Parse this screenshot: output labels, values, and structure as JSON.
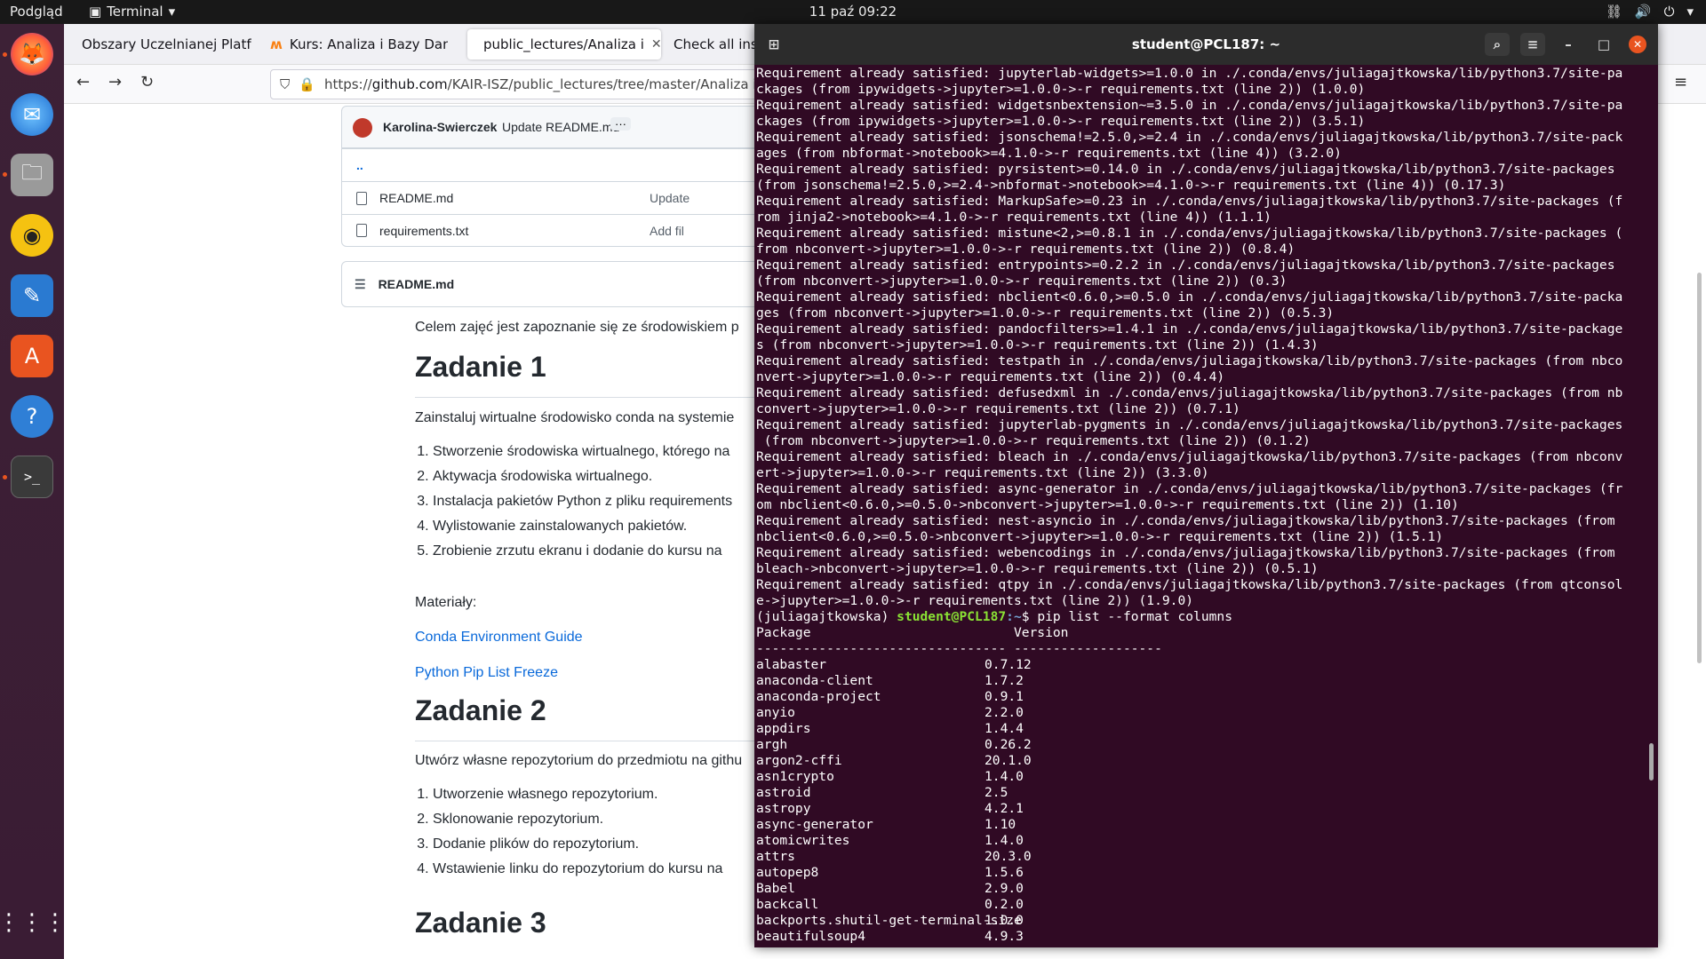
{
  "topbar": {
    "activities": "Podgląd",
    "app": "Terminal",
    "clock": "11 paź  09:22"
  },
  "dock": {
    "items": [
      "firefox-icon",
      "thunderbird-icon",
      "files-icon",
      "rhythmbox-icon",
      "writer-icon",
      "software-icon",
      "help-icon",
      "terminal-icon",
      "apps-grid-icon"
    ]
  },
  "browser": {
    "tabs": [
      {
        "label": "Obszary Uczelnianej Platf",
        "favicon": "#e07b00"
      },
      {
        "label": "Kurs: Analiza i Bazy Dany",
        "favicon": "#f98012"
      },
      {
        "label": "public_lectures/Analiza i",
        "favicon": "#24292f"
      },
      {
        "label": "Check all insta",
        "favicon": ""
      }
    ],
    "url_prefix": "https://",
    "url_domain": "github.com",
    "url_path": "/KAIR-ISZ/public_lectures/tree/master/Analiza i Ba"
  },
  "github": {
    "commit_author": "Karolina-Swierczek",
    "commit_msg": "Update README.md",
    "parent": "..",
    "files": [
      {
        "name": "README.md",
        "commit": "Update"
      },
      {
        "name": "requirements.txt",
        "commit": "Add fil"
      }
    ],
    "readme_title": "README.md",
    "intro": "Celem zajęć jest zapoznanie się ze środowiskiem p",
    "z1": "Zadanie 1",
    "z1_text": "Zainstaluj wirtualne środowisko conda na systemie",
    "z1_items": [
      "Stworzenie środowiska wirtualnego, którego na",
      "Aktywacja środowiska wirtualnego.",
      "Instalacja pakietów Python z pliku requirements",
      "Wylistowanie zainstalowanych pakietów.",
      "Zrobienie zrzutu ekranu i dodanie do kursu na"
    ],
    "materials": "Materiały:",
    "link1": "Conda Environment Guide",
    "link2": "Python Pip List Freeze",
    "z2": "Zadanie 2",
    "z2_text": "Utwórz własne repozytorium do przedmiotu na githu",
    "z2_items": [
      "Utworzenie własnego repozytorium.",
      "Sklonowanie repozytorium.",
      "Dodanie plików do repozytorium.",
      "Wstawienie linku do repozytorium do kursu na"
    ],
    "z3": "Zadanie 3"
  },
  "terminal": {
    "title": "student@PCL187: ~",
    "lines": [
      "Requirement already satisfied: jupyterlab-widgets>=1.0.0 in ./.conda/envs/juliagajtkowska/lib/python3.7/site-pa",
      "ckages (from ipywidgets->jupyter>=1.0.0->-r requirements.txt (line 2)) (1.0.0)",
      "Requirement already satisfied: widgetsnbextension~=3.5.0 in ./.conda/envs/juliagajtkowska/lib/python3.7/site-pa",
      "ckages (from ipywidgets->jupyter>=1.0.0->-r requirements.txt (line 2)) (3.5.1)",
      "Requirement already satisfied: jsonschema!=2.5.0,>=2.4 in ./.conda/envs/juliagajtkowska/lib/python3.7/site-pack",
      "ages (from nbformat->notebook>=4.1.0->-r requirements.txt (line 4)) (3.2.0)",
      "Requirement already satisfied: pyrsistent>=0.14.0 in ./.conda/envs/juliagajtkowska/lib/python3.7/site-packages",
      "(from jsonschema!=2.5.0,>=2.4->nbformat->notebook>=4.1.0->-r requirements.txt (line 4)) (0.17.3)",
      "Requirement already satisfied: MarkupSafe>=0.23 in ./.conda/envs/juliagajtkowska/lib/python3.7/site-packages (f",
      "rom jinja2->notebook>=4.1.0->-r requirements.txt (line 4)) (1.1.1)",
      "Requirement already satisfied: mistune<2,>=0.8.1 in ./.conda/envs/juliagajtkowska/lib/python3.7/site-packages (",
      "from nbconvert->jupyter>=1.0.0->-r requirements.txt (line 2)) (0.8.4)",
      "Requirement already satisfied: entrypoints>=0.2.2 in ./.conda/envs/juliagajtkowska/lib/python3.7/site-packages",
      "(from nbconvert->jupyter>=1.0.0->-r requirements.txt (line 2)) (0.3)",
      "Requirement already satisfied: nbclient<0.6.0,>=0.5.0 in ./.conda/envs/juliagajtkowska/lib/python3.7/site-packa",
      "ges (from nbconvert->jupyter>=1.0.0->-r requirements.txt (line 2)) (0.5.3)",
      "Requirement already satisfied: pandocfilters>=1.4.1 in ./.conda/envs/juliagajtkowska/lib/python3.7/site-package",
      "s (from nbconvert->jupyter>=1.0.0->-r requirements.txt (line 2)) (1.4.3)",
      "Requirement already satisfied: testpath in ./.conda/envs/juliagajtkowska/lib/python3.7/site-packages (from nbco",
      "nvert->jupyter>=1.0.0->-r requirements.txt (line 2)) (0.4.4)",
      "Requirement already satisfied: defusedxml in ./.conda/envs/juliagajtkowska/lib/python3.7/site-packages (from nb",
      "convert->jupyter>=1.0.0->-r requirements.txt (line 2)) (0.7.1)",
      "Requirement already satisfied: jupyterlab-pygments in ./.conda/envs/juliagajtkowska/lib/python3.7/site-packages",
      " (from nbconvert->jupyter>=1.0.0->-r requirements.txt (line 2)) (0.1.2)",
      "Requirement already satisfied: bleach in ./.conda/envs/juliagajtkowska/lib/python3.7/site-packages (from nbconv",
      "ert->jupyter>=1.0.0->-r requirements.txt (line 2)) (3.3.0)",
      "Requirement already satisfied: async-generator in ./.conda/envs/juliagajtkowska/lib/python3.7/site-packages (fr",
      "om nbclient<0.6.0,>=0.5.0->nbconvert->jupyter>=1.0.0->-r requirements.txt (line 2)) (1.10)",
      "Requirement already satisfied: nest-asyncio in ./.conda/envs/juliagajtkowska/lib/python3.7/site-packages (from",
      "nbclient<0.6.0,>=0.5.0->nbconvert->jupyter>=1.0.0->-r requirements.txt (line 2)) (1.5.1)",
      "Requirement already satisfied: webencodings in ./.conda/envs/juliagajtkowska/lib/python3.7/site-packages (from",
      "bleach->nbconvert->jupyter>=1.0.0->-r requirements.txt (line 2)) (0.5.1)",
      "Requirement already satisfied: qtpy in ./.conda/envs/juliagajtkowska/lib/python3.7/site-packages (from qtconsol",
      "e->jupyter>=1.0.0->-r requirements.txt (line 2)) (1.9.0)"
    ],
    "prompt_env": "(juliagajtkowska) ",
    "prompt_user": "student@PCL187",
    "prompt_path": ":~",
    "prompt_cmd": "$ pip list --format columns",
    "pkg_header": "Package                          Version",
    "pkg_sep": "-------------------------------- -------------------",
    "packages": [
      [
        "alabaster",
        "0.7.12"
      ],
      [
        "anaconda-client",
        "1.7.2"
      ],
      [
        "anaconda-project",
        "0.9.1"
      ],
      [
        "anyio",
        "2.2.0"
      ],
      [
        "appdirs",
        "1.4.4"
      ],
      [
        "argh",
        "0.26.2"
      ],
      [
        "argon2-cffi",
        "20.1.0"
      ],
      [
        "asn1crypto",
        "1.4.0"
      ],
      [
        "astroid",
        "2.5"
      ],
      [
        "astropy",
        "4.2.1"
      ],
      [
        "async-generator",
        "1.10"
      ],
      [
        "atomicwrites",
        "1.4.0"
      ],
      [
        "attrs",
        "20.3.0"
      ],
      [
        "autopep8",
        "1.5.6"
      ],
      [
        "Babel",
        "2.9.0"
      ],
      [
        "backcall",
        "0.2.0"
      ],
      [
        "backports.shutil-get-terminal-size",
        "1.0.0"
      ],
      [
        "beautifulsoup4",
        "4.9.3"
      ]
    ]
  }
}
